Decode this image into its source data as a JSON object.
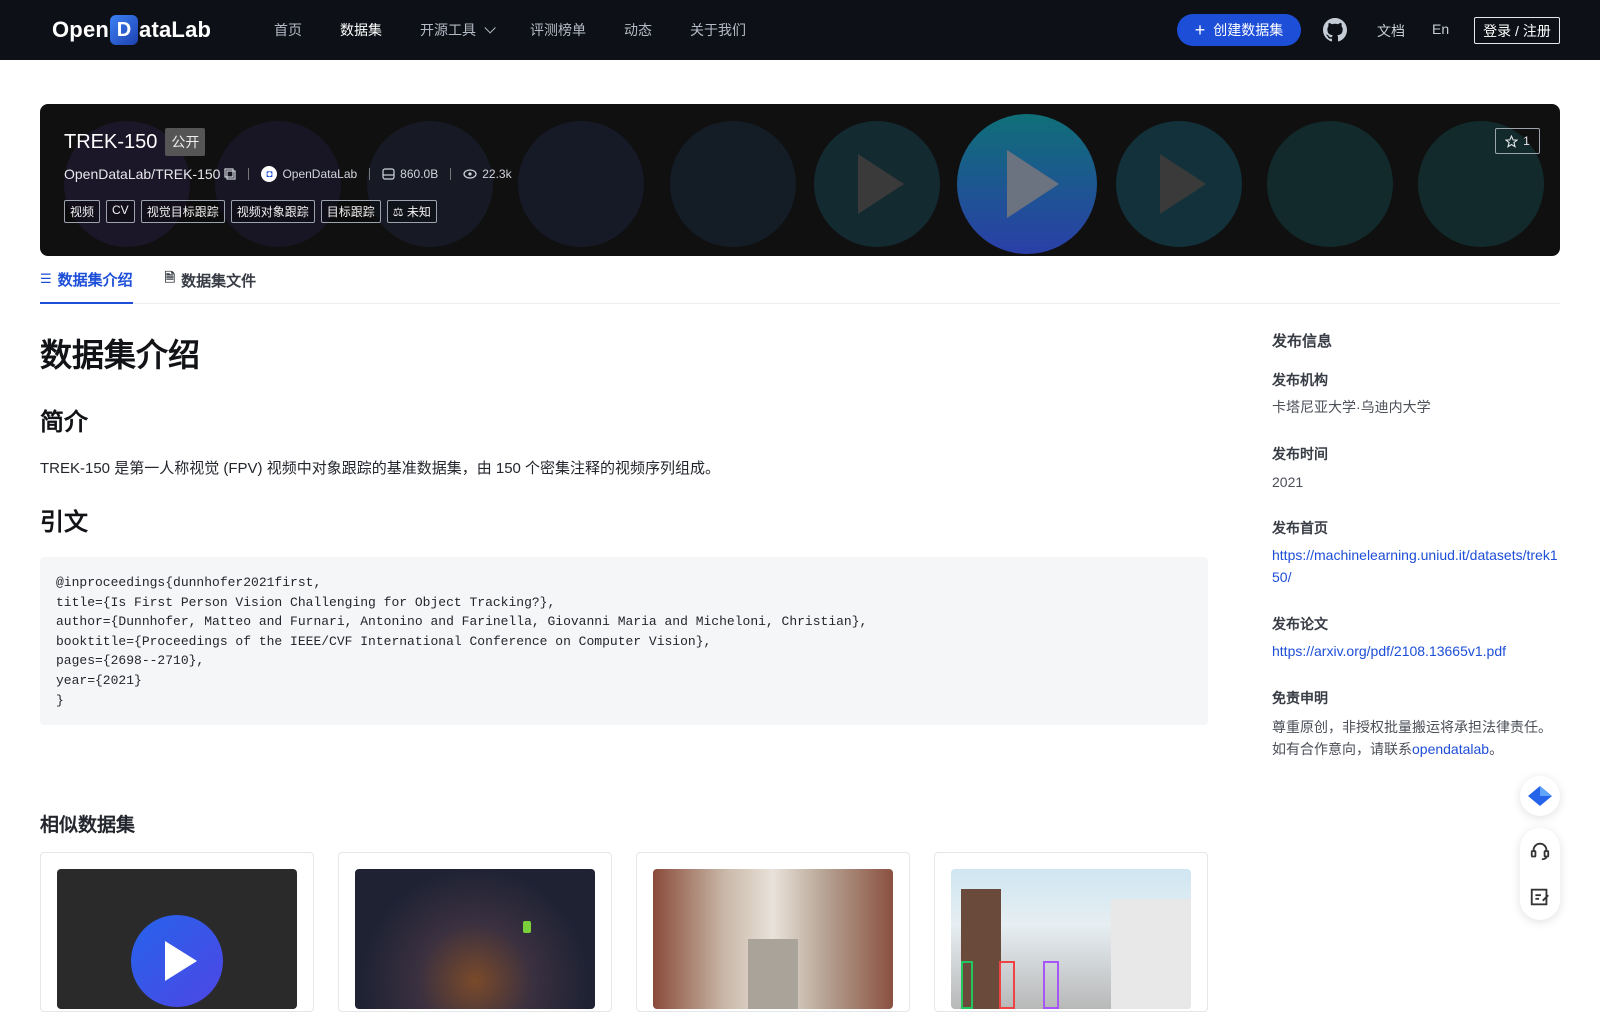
{
  "nav": {
    "logo_text_left": "Open",
    "logo_d": "D",
    "logo_text_right": "ataLab",
    "links": [
      "首页",
      "数据集",
      "开源工具",
      "评测榜单",
      "动态",
      "关于我们"
    ],
    "active_link": "数据集",
    "create_btn": "创建数据集",
    "docs": "文档",
    "lang": "En",
    "login": "登录 / 注册"
  },
  "dataset": {
    "title": "TREK-150",
    "visibility": "公开",
    "path": "OpenDataLab/TREK-150",
    "org": "OpenDataLab",
    "size": "860.0B",
    "views": "22.3k",
    "tags": [
      "视频",
      "CV",
      "视觉目标跟踪",
      "视频对象跟踪",
      "目标跟踪",
      "未知"
    ],
    "stars": "1"
  },
  "tabs": [
    "数据集介绍",
    "数据集文件"
  ],
  "content": {
    "h1": "数据集介绍",
    "intro_heading": "简介",
    "intro_text": "TREK-150 是第一人称视觉 (FPV) 视频中对象跟踪的基准数据集，由 150 个密集注释的视频序列组成。",
    "cite_heading": "引文",
    "citation": "@inproceedings{dunnhofer2021first,\ntitle={Is First Person Vision Challenging for Object Tracking?},\nauthor={Dunnhofer, Matteo and Furnari, Antonino and Farinella, Giovanni Maria and Micheloni, Christian},\nbooktitle={Proceedings of the IEEE/CVF International Conference on Computer Vision},\npages={2698--2710},\nyear={2021}\n}",
    "similar_heading": "相似数据集"
  },
  "sidebar": {
    "title": "发布信息",
    "org_label": "发布机构",
    "org_value": "卡塔尼亚大学·乌迪内大学",
    "time_label": "发布时间",
    "time_value": "2021",
    "home_label": "发布首页",
    "home_value": "https://machinelearning.uniud.it/datasets/trek150/",
    "paper_label": "发布论文",
    "paper_value": "https://arxiv.org/pdf/2108.13665v1.pdf",
    "disclaimer_label": "免责申明",
    "disclaimer_line1": "尊重原创，非授权批量搬运将承担法律责任。",
    "disclaimer_line2_prefix": "如有合作意向，请联系",
    "disclaimer_link": "opendatalab",
    "disclaimer_suffix": "。"
  },
  "colors": {
    "nav_bg": "#0d1117",
    "accent": "#1d4ed8",
    "banner_bg": "#101010"
  },
  "icons": [
    "github-icon",
    "star-icon",
    "copy-icon",
    "storage-icon",
    "eye-icon",
    "database-icon",
    "file-icon",
    "scale-icon",
    "play-icon",
    "diamond-icon",
    "headset-icon",
    "edit-icon"
  ]
}
